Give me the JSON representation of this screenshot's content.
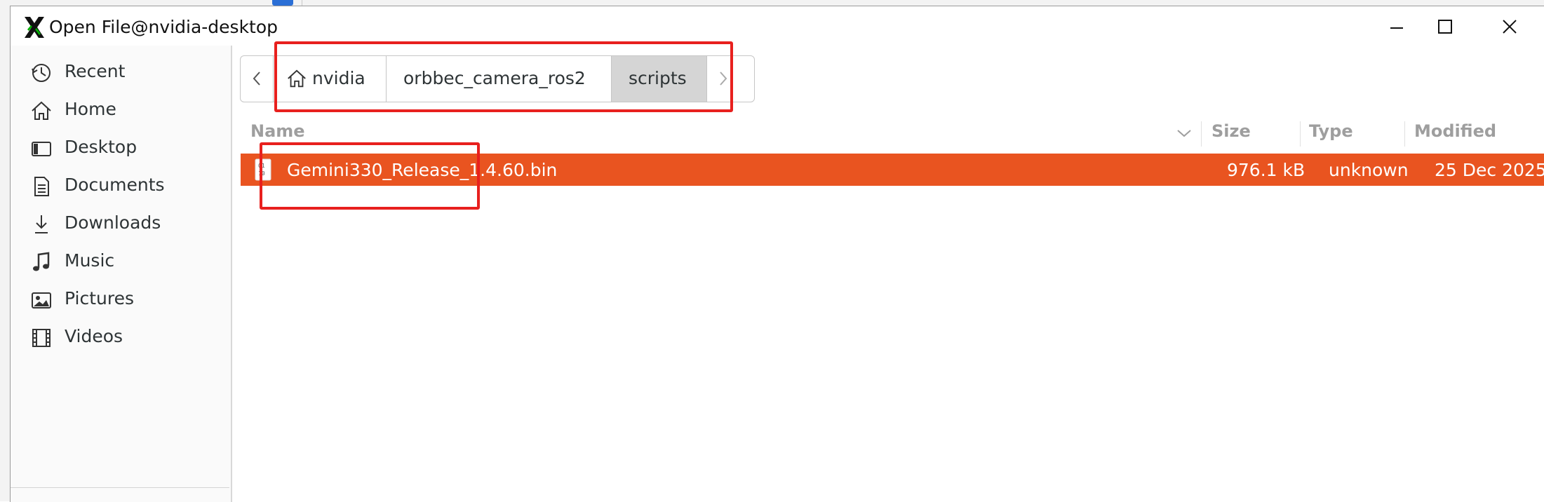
{
  "window": {
    "title": "Open File@nvidia-desktop",
    "controls": [
      "minimize",
      "maximize",
      "close"
    ]
  },
  "sidebar": {
    "items": [
      {
        "label": "Recent",
        "icon": "clock-icon"
      },
      {
        "label": "Home",
        "icon": "home-icon"
      },
      {
        "label": "Desktop",
        "icon": "desktop-icon"
      },
      {
        "label": "Documents",
        "icon": "document-icon"
      },
      {
        "label": "Downloads",
        "icon": "download-icon"
      },
      {
        "label": "Music",
        "icon": "music-note-icon"
      },
      {
        "label": "Pictures",
        "icon": "picture-icon"
      },
      {
        "label": "Videos",
        "icon": "film-icon"
      }
    ]
  },
  "pathbar": {
    "segments": [
      "nvidia",
      "orbbec_camera_ros2",
      "scripts"
    ],
    "active_segment": "scripts"
  },
  "file_list": {
    "columns": [
      "Name",
      "Size",
      "Type",
      "Modified"
    ],
    "sort_column": "Name",
    "rows": [
      {
        "name": "Gemini330_Release_1.4.60.bin",
        "size": "976.1 kB",
        "type": "unknown",
        "modified": "25 Dec 2025",
        "selected": true
      }
    ]
  },
  "colors": {
    "selection": "#e95420",
    "annotation": "#e8201e",
    "header_text": "#9e9e9e"
  }
}
